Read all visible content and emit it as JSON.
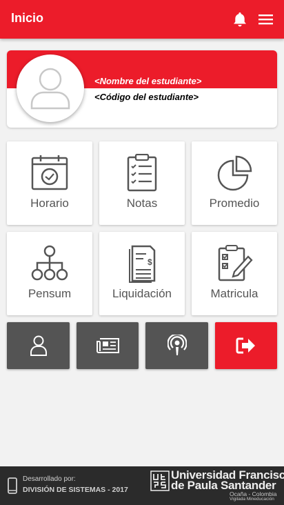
{
  "appbar": {
    "title": "Inicio",
    "bell_icon": "bell-icon",
    "menu_icon": "hamburger-menu-icon",
    "color": "#ec1c2a"
  },
  "profile": {
    "name_placeholder": "<Nombre del estudiante>",
    "code_placeholder": "<Código del estudiante>",
    "avatar_icon": "user-avatar-icon"
  },
  "tiles": [
    {
      "label": "Horario",
      "icon": "calendar-clock-icon"
    },
    {
      "label": "Notas",
      "icon": "clipboard-checklist-icon"
    },
    {
      "label": "Promedio",
      "icon": "pie-chart-icon"
    },
    {
      "label": "Pensum",
      "icon": "hierarchy-tree-icon"
    },
    {
      "label": "Liquidación",
      "icon": "invoice-document-icon"
    },
    {
      "label": "Matricula",
      "icon": "clipboard-pencil-icon"
    }
  ],
  "actions": [
    {
      "icon": "user-icon",
      "color": "#545454"
    },
    {
      "icon": "newspaper-icon",
      "color": "#545454"
    },
    {
      "icon": "podcast-icon",
      "color": "#545454"
    },
    {
      "icon": "logout-icon",
      "color": "#ec1c2a"
    }
  ],
  "footer": {
    "developed_by": "Desarrollado por:",
    "division": "DIVISIÓN DE SISTEMAS - 2017",
    "university_line1": "Universidad Francisco",
    "university_line2": "de Paula Santander",
    "location": "Ocaña - Colombia",
    "supervision": "Vigilada Mineducación",
    "logo_icon": "ufps-logo-icon",
    "phone_icon": "mobile-phone-icon"
  }
}
